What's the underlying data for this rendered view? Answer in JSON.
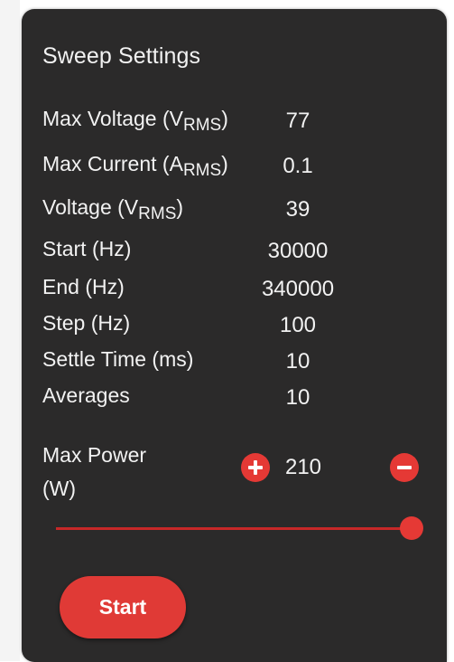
{
  "panel": {
    "title": "Sweep Settings"
  },
  "settings": [
    {
      "label": "Max Voltage (V",
      "sub": "RMS",
      "suffix": ")",
      "value": "77"
    },
    {
      "label": "Max Current (A",
      "sub": "RMS",
      "suffix": ")",
      "value": "0.1"
    },
    {
      "label": "Voltage (V",
      "sub": "RMS",
      "suffix": ")",
      "value": "39"
    },
    {
      "label": "Start (Hz)",
      "sub": "",
      "suffix": "",
      "value": "30000"
    },
    {
      "label": "End (Hz)",
      "sub": "",
      "suffix": "",
      "value": "340000"
    },
    {
      "label": "Step (Hz)",
      "sub": "",
      "suffix": "",
      "value": "100"
    },
    {
      "label": "Settle Time (ms)",
      "sub": "",
      "suffix": "",
      "value": "10"
    },
    {
      "label": "Averages",
      "sub": "",
      "suffix": "",
      "value": "10"
    }
  ],
  "max_power": {
    "label_line1": "Max Power",
    "label_line2": "(W)",
    "value": "210",
    "increment_icon": "plus-circle-icon",
    "decrement_icon": "minus-circle-icon",
    "slider_level": 1.0
  },
  "start_button": {
    "label": "Start"
  },
  "colors": {
    "panel_bg": "#2b2a2a",
    "accent": "#e53935",
    "text": "#f2f2f2"
  }
}
